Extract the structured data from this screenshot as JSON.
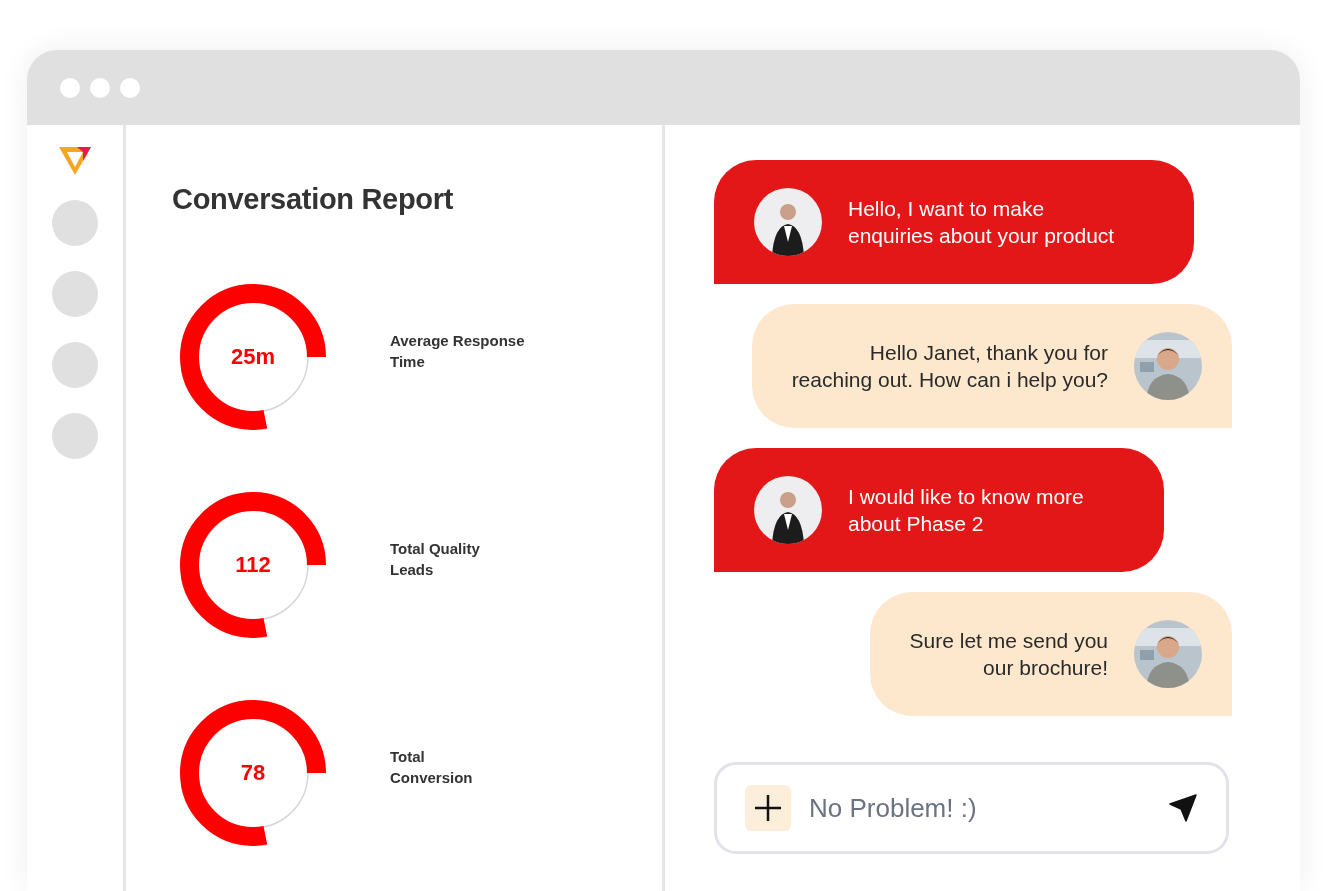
{
  "report": {
    "title": "Conversation Report",
    "metrics": [
      {
        "value": "25m",
        "label": "Average Response\nTime",
        "level": 0.78
      },
      {
        "value": "112",
        "label": "Total Quality\nLeads",
        "level": 0.78
      },
      {
        "value": "78",
        "label": "Total\nConversion",
        "level": 0.78
      }
    ]
  },
  "chat": {
    "messages": [
      {
        "kind": "received",
        "text": "Hello, I want to make\nenquiries about your product"
      },
      {
        "kind": "sent",
        "text": "Hello Janet, thank you for\nreaching out. How can i help you?"
      },
      {
        "kind": "received",
        "text": "I would like to know more\nabout Phase 2"
      },
      {
        "kind": "sent",
        "text": "Sure let me send you\nour brochure!"
      }
    ],
    "composer": {
      "value": "No Problem! :)"
    }
  }
}
